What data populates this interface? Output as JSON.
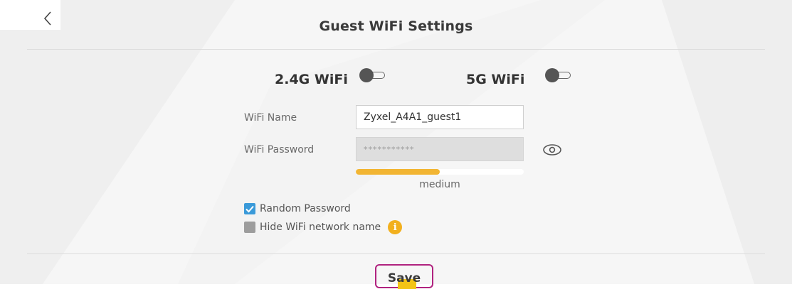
{
  "header": {
    "title": "Guest WiFi Settings",
    "back_icon": "chevron-left-icon"
  },
  "bands": [
    {
      "label": "2.4G WiFi",
      "enabled": false
    },
    {
      "label": "5G WiFi",
      "enabled": false
    }
  ],
  "form": {
    "wifi_name_label": "WiFi Name",
    "wifi_name_value": "Zyxel_A4A1_guest1",
    "wifi_password_label": "WiFi Password",
    "wifi_password_value": "***********",
    "password_visibility_icon": "eye-icon",
    "strength_label": "medium",
    "strength_fraction": 0.5,
    "strength_color": "#f2b533"
  },
  "options": {
    "random_password_label": "Random Password",
    "random_password_checked": true,
    "hide_ssid_label": "Hide WiFi network name",
    "hide_ssid_checked": false,
    "info_icon": "info-icon",
    "info_glyph": "i"
  },
  "footer": {
    "save_label": "Save"
  },
  "colors": {
    "accent": "#3a9ad9",
    "highlight_border": "#b0227f",
    "warning": "#f2b01e"
  }
}
